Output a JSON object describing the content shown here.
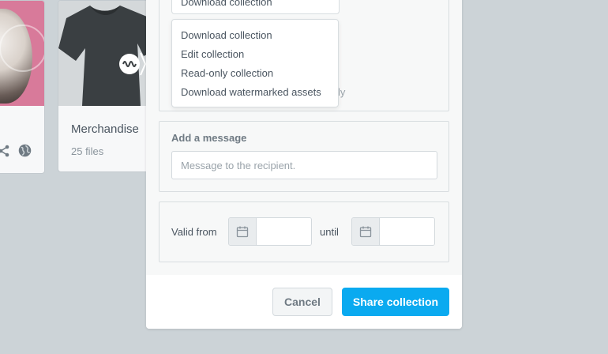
{
  "background": {
    "cards": [
      {
        "title": "",
        "subtitle": ""
      },
      {
        "title": "Merchandise",
        "subtitle": "25 files"
      }
    ]
  },
  "modal": {
    "permission": {
      "selected": "Download collection",
      "ghost_suffix": "ly",
      "options": [
        "Download collection",
        "Edit collection",
        "Read-only collection",
        "Download watermarked assets"
      ]
    },
    "message": {
      "label": "Add a message",
      "placeholder": "Message to the recipient.",
      "value": ""
    },
    "validity": {
      "from_label": "Valid from",
      "until_label": "until",
      "from_value": "",
      "until_value": ""
    },
    "footer": {
      "cancel_label": "Cancel",
      "share_label": "Share collection"
    }
  },
  "icons": {
    "share": "share-icon",
    "globe": "globe-icon",
    "calendar": "calendar-icon"
  },
  "colors": {
    "backdrop": "#ccd3d7",
    "accent": "#0aaaf0",
    "panel_border": "#d8dde0"
  }
}
